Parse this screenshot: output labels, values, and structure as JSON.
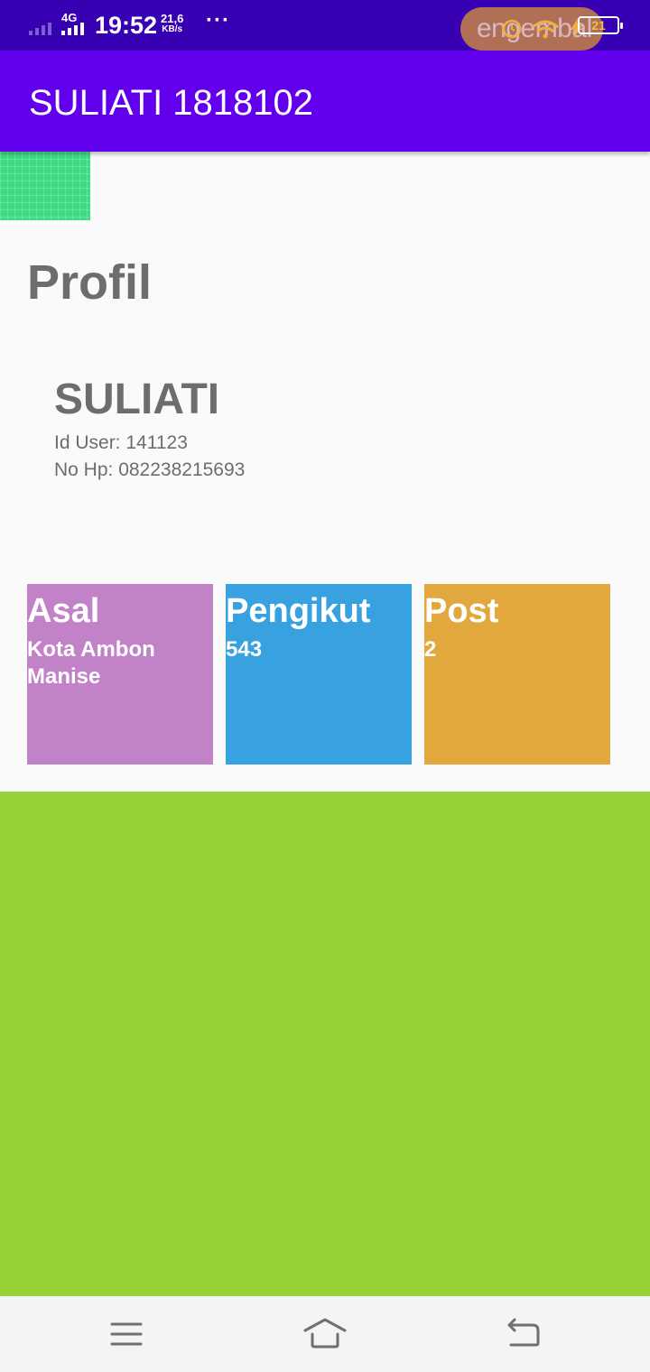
{
  "status_bar": {
    "network": "4G",
    "time": "19:52",
    "speed_value": "21,6",
    "speed_unit": "KB/s",
    "more": "···",
    "pill_text": "engembal",
    "battery": "21"
  },
  "app_bar": {
    "title": "SULIATI 1818102"
  },
  "profile": {
    "section_title": "Profil",
    "name": "SULIATI",
    "id_line": "Id User: 141123",
    "phone_line": "No Hp: 082238215693"
  },
  "tiles": [
    {
      "title": "Asal",
      "value": "Kota Ambon Manise"
    },
    {
      "title": "Pengikut",
      "value": "543"
    },
    {
      "title": "Post",
      "value": "2"
    }
  ],
  "colors": {
    "status_bar": "#3700b3",
    "app_bar": "#6200ee",
    "thumb": "#3ddc84",
    "tile_asal": "#c282c8",
    "tile_pengikut": "#38a2e0",
    "tile_post": "#e2a83e",
    "green_panel": "#96d136"
  },
  "icons": {
    "nav_menu": "menu-icon",
    "nav_home": "home-icon",
    "nav_back": "back-icon"
  }
}
